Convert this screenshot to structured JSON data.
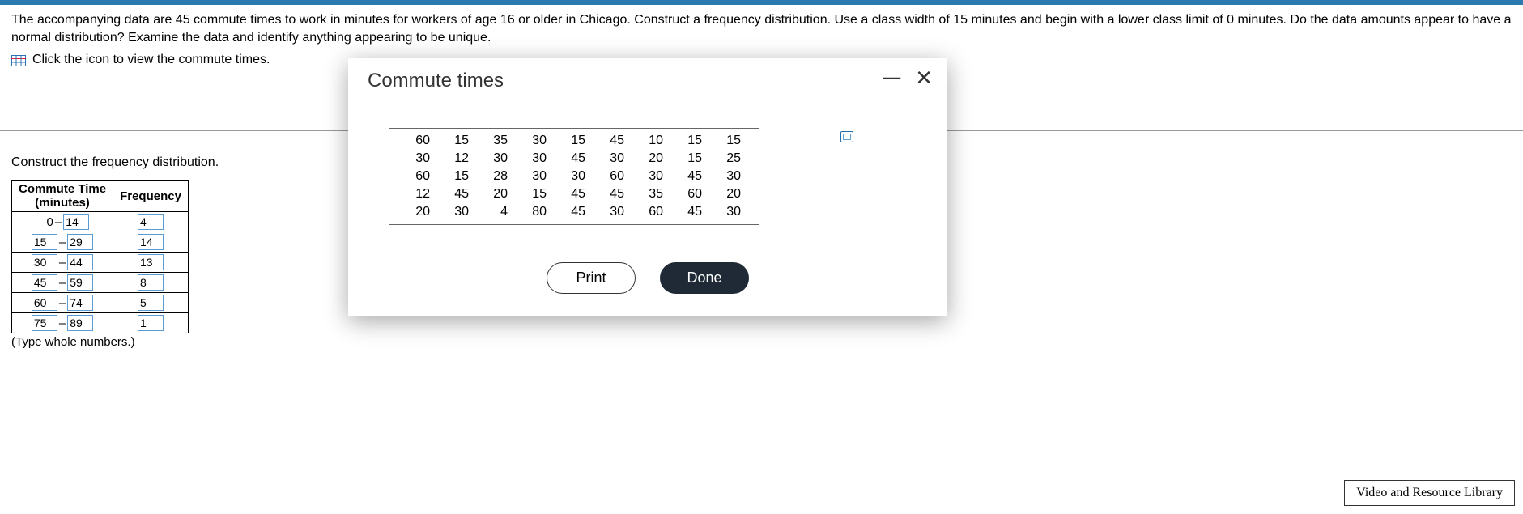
{
  "question": {
    "text": "The accompanying data are 45 commute times to work in minutes for workers of age 16 or older in Chicago. Construct a frequency distribution. Use a class width of 15 minutes and begin with a lower class limit of 0 minutes. Do the data amounts appear to have a normal distribution? Examine the data and identify anything appearing to be unique.",
    "link_text": "Click the icon to view the commute times."
  },
  "section": {
    "instruction": "Construct the frequency distribution.",
    "hint": "(Type whole numbers.)",
    "table": {
      "header_left": "Commute Time (minutes)",
      "header_right": "Frequency",
      "rows": [
        {
          "lo": "0",
          "hi": "14",
          "freq": "4"
        },
        {
          "lo": "15",
          "hi": "29",
          "freq": "14"
        },
        {
          "lo": "30",
          "hi": "44",
          "freq": "13"
        },
        {
          "lo": "45",
          "hi": "59",
          "freq": "8"
        },
        {
          "lo": "60",
          "hi": "74",
          "freq": "5"
        },
        {
          "lo": "75",
          "hi": "89",
          "freq": "1"
        }
      ]
    }
  },
  "modal": {
    "title": "Commute times",
    "print": "Print",
    "done": "Done",
    "data": [
      [
        "60",
        "15",
        "35",
        "30",
        "15",
        "45",
        "10",
        "15",
        "15"
      ],
      [
        "30",
        "12",
        "30",
        "30",
        "45",
        "30",
        "20",
        "15",
        "25"
      ],
      [
        "60",
        "15",
        "28",
        "30",
        "30",
        "60",
        "30",
        "45",
        "30"
      ],
      [
        "12",
        "45",
        "20",
        "15",
        "45",
        "45",
        "35",
        "60",
        "20"
      ],
      [
        "20",
        "30",
        "4",
        "80",
        "45",
        "30",
        "60",
        "45",
        "30"
      ]
    ]
  },
  "footer": {
    "resource": "Video and Resource Library"
  }
}
